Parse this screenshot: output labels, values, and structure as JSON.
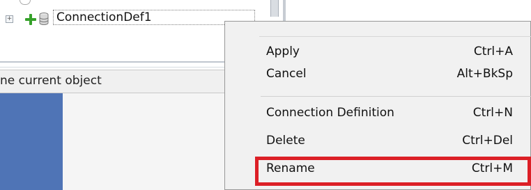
{
  "tree": {
    "node_label": "ConnectionDef1"
  },
  "status_bar": {
    "text": "ne current object"
  },
  "context_menu": {
    "items_group1": [
      {
        "label": "Apply",
        "shortcut": "Ctrl+A"
      },
      {
        "label": "Cancel",
        "shortcut": "Alt+BkSp"
      }
    ],
    "items_group2": [
      {
        "label": "Connection Definition",
        "shortcut": "Ctrl+N"
      },
      {
        "label": "Delete",
        "shortcut": "Ctrl+Del"
      },
      {
        "label": "Rename",
        "shortcut": "Ctrl+M"
      }
    ]
  },
  "colors": {
    "highlight": "#dc1f26",
    "blue_panel": "#4f74b6",
    "plus_icon": "#36a12a"
  },
  "icons": [
    "expander-icon",
    "add-icon",
    "database-icon"
  ]
}
